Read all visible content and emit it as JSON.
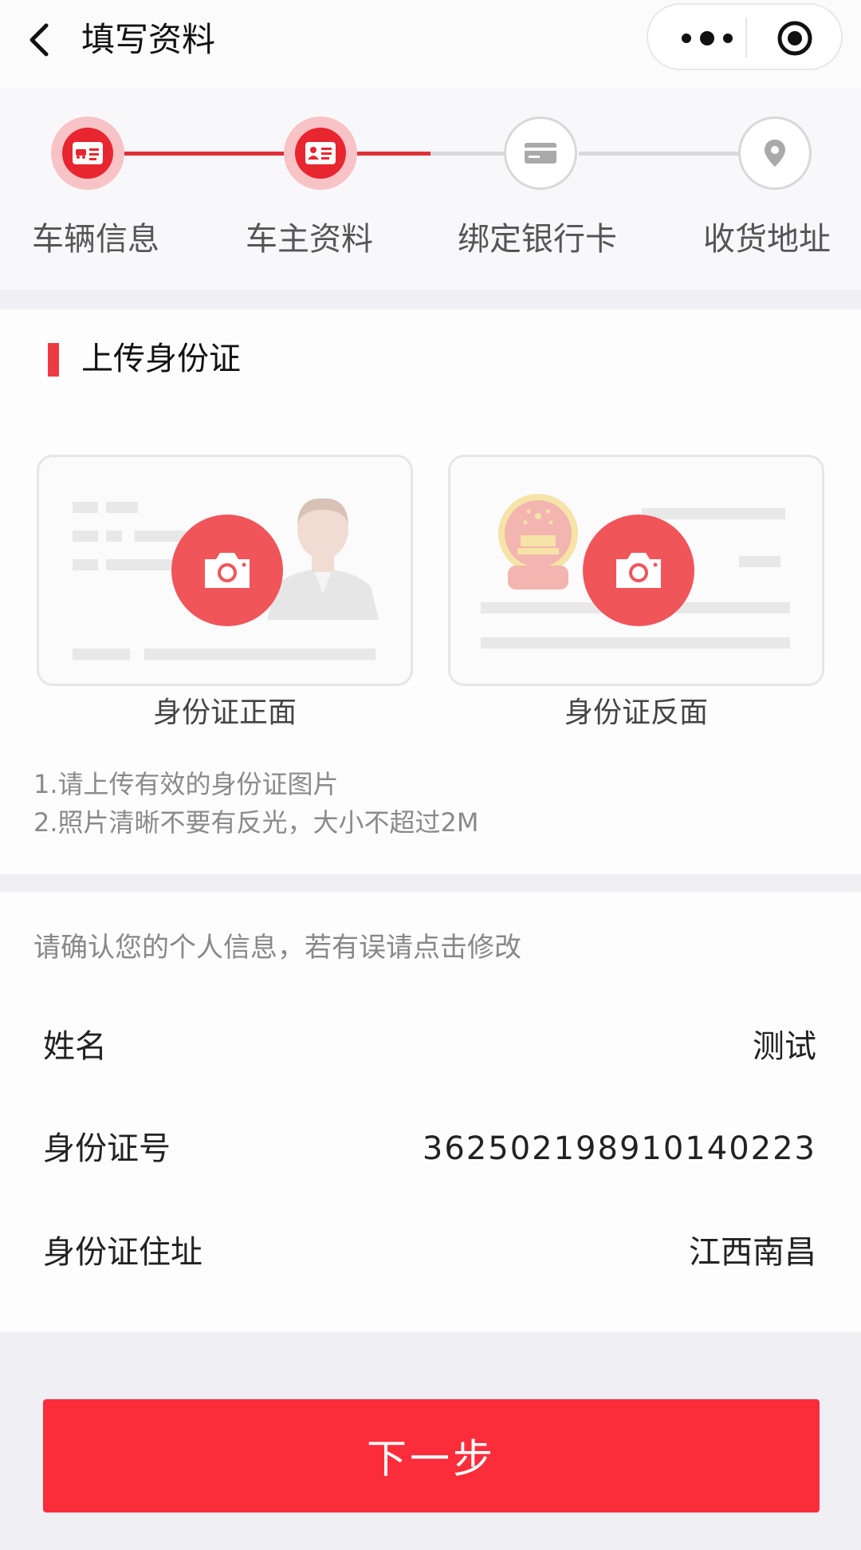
{
  "nav": {
    "title": "填写资料",
    "back_icon": "chevron-left-icon",
    "more_icon": "more-dots-icon",
    "close_icon": "target-close-icon"
  },
  "steps": [
    {
      "label": "车辆信息",
      "icon": "vehicle-license-icon",
      "state": "done"
    },
    {
      "label": "车主资料",
      "icon": "id-card-icon",
      "state": "active"
    },
    {
      "label": "绑定银行卡",
      "icon": "bank-card-icon",
      "state": "todo"
    },
    {
      "label": "收货地址",
      "icon": "location-pin-icon",
      "state": "todo"
    }
  ],
  "upload": {
    "title": "上传身份证",
    "front_label": "身份证正面",
    "back_label": "身份证反面",
    "hints": [
      "1.请上传有效的身份证图片",
      "2.照片清晰不要有反光，大小不超过2M"
    ]
  },
  "info": {
    "note": "请确认您的个人信息，若有误请点击修改",
    "rows": [
      {
        "label": "姓名",
        "value": "测试"
      },
      {
        "label": "身份证号",
        "value": "362502198910140223"
      },
      {
        "label": "身份证住址",
        "value": "江西南昌"
      }
    ]
  },
  "next_button": "下一步",
  "colors": {
    "accent": "#e8262f",
    "button": "#fb2d3b",
    "camera": "#f0555a",
    "background": "#efeff4"
  }
}
